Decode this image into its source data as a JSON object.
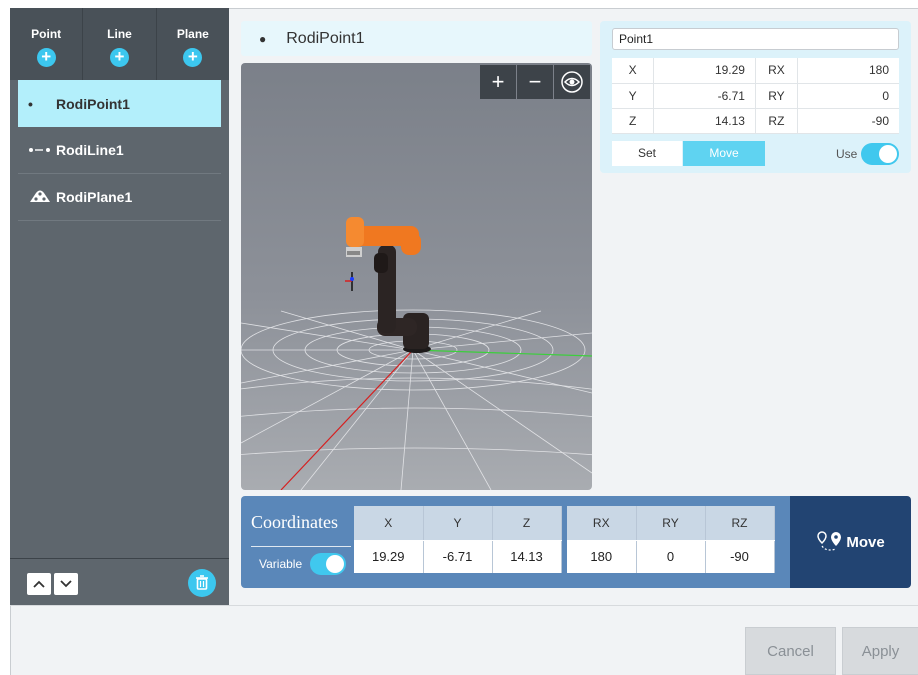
{
  "sidebar": {
    "columns": [
      {
        "label": "Point"
      },
      {
        "label": "Line"
      },
      {
        "label": "Plane"
      }
    ],
    "items": [
      {
        "label": "RodiPoint1",
        "icon": "dot-icon"
      },
      {
        "label": "RodiLine1",
        "icon": "line-icon"
      },
      {
        "label": "RodiPlane1",
        "icon": "plane-icon"
      }
    ]
  },
  "title": "RodiPoint1",
  "point": {
    "name": "Point1",
    "rows": [
      {
        "a": "X",
        "av": "19.29",
        "b": "RX",
        "bv": "180"
      },
      {
        "a": "Y",
        "av": "-6.71",
        "b": "RY",
        "bv": "0"
      },
      {
        "a": "Z",
        "av": "14.13",
        "b": "RZ",
        "bv": "-90"
      }
    ],
    "set_label": "Set",
    "move_label": "Move",
    "use_label": "Use"
  },
  "coordinates": {
    "title": "Coordinates",
    "variable_label": "Variable",
    "headers": [
      "X",
      "Y",
      "Z",
      "RX",
      "RY",
      "RZ"
    ],
    "values": [
      "19.29",
      "-6.71",
      "14.13",
      "180",
      "0",
      "-90"
    ]
  },
  "move_button": "Move",
  "footer": {
    "cancel": "Cancel",
    "apply": "Apply"
  },
  "colors": {
    "accent": "#3cc7ef",
    "sidebar": "#5e666d",
    "robot_orange": "#f07820"
  }
}
